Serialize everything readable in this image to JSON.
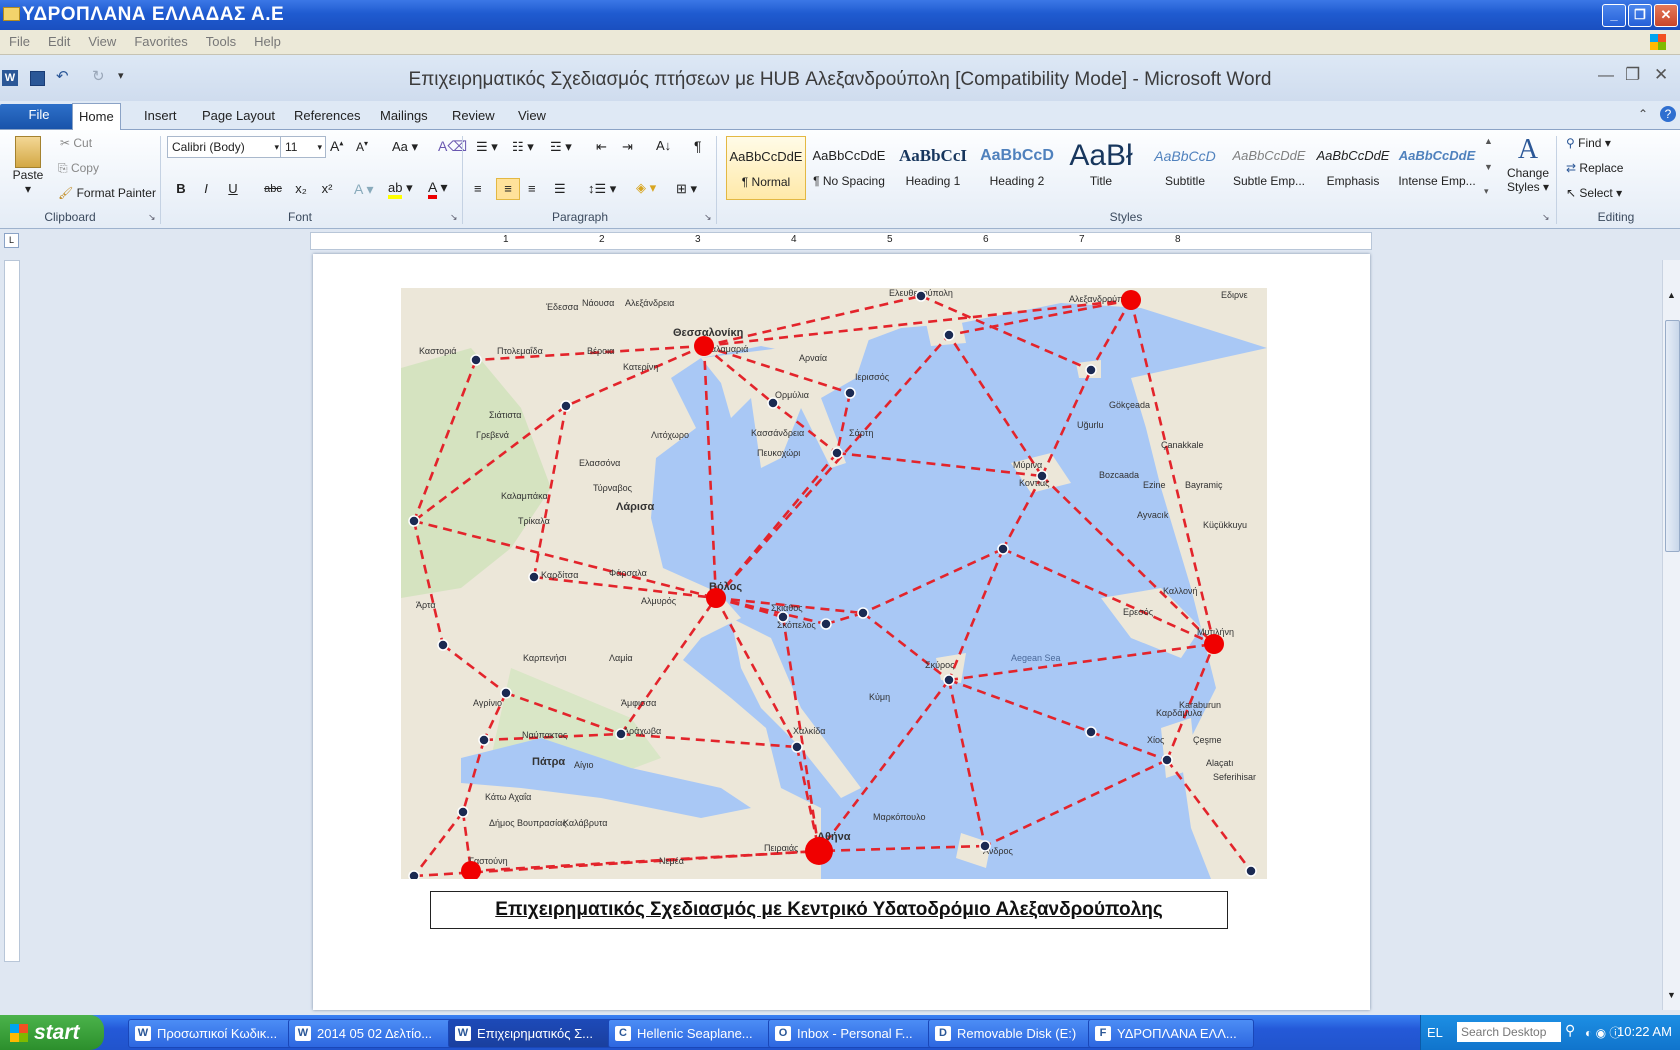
{
  "xp_window": {
    "title": "ΥΔΡΟΠΛΑΝΑ ΕΛΛΑΔΑΣ Α.Ε",
    "menu": [
      "File",
      "Edit",
      "View",
      "Favorites",
      "Tools",
      "Help"
    ]
  },
  "word": {
    "title": "Επιχειρηματικός Σχεδιασμός  πτήσεων με HUB Αλεξανδρούπολη [Compatibility Mode]  -  Microsoft Word",
    "tabs": [
      "File",
      "Home",
      "Insert",
      "Page Layout",
      "References",
      "Mailings",
      "Review",
      "View"
    ],
    "active_tab": "Home",
    "clipboard": {
      "paste": "Paste",
      "cut": "Cut",
      "copy": "Copy",
      "format_painter": "Format Painter",
      "label": "Clipboard"
    },
    "font": {
      "name": "Calibri (Body)",
      "size": "11",
      "label": "Font",
      "buttons": [
        "B",
        "I",
        "U",
        "abc",
        "x₂",
        "x²"
      ]
    },
    "paragraph": {
      "label": "Paragraph"
    },
    "styles": {
      "label": "Styles",
      "items": [
        {
          "sample": "AaBbCcDdE",
          "name": "¶ Normal"
        },
        {
          "sample": "AaBbCcDdE",
          "name": "¶ No Spacing"
        },
        {
          "sample": "AaBbCcI",
          "name": "Heading 1"
        },
        {
          "sample": "AaBbCcD",
          "name": "Heading 2"
        },
        {
          "sample": "AaBł",
          "name": "Title"
        },
        {
          "sample": "AaBbCcD",
          "name": "Subtitle"
        },
        {
          "sample": "AaBbCcDdE",
          "name": "Subtle Emp..."
        },
        {
          "sample": "AaBbCcDdE",
          "name": "Emphasis"
        },
        {
          "sample": "AaBbCcDdE",
          "name": "Intense Emp..."
        }
      ],
      "change_styles": "Change Styles"
    },
    "editing": {
      "label": "Editing",
      "find": "Find",
      "replace": "Replace",
      "select": "Select"
    },
    "ruler_numbers": [
      "1",
      "2",
      "3",
      "4",
      "5",
      "6",
      "7",
      "8"
    ],
    "caption": "Επιχειρηματικός Σχεδιασμός με Κεντρικό Υδατοδρόμιο Αλεξανδρούπολης"
  },
  "map": {
    "labels": [
      "Ελευθερούπολη",
      "Αλεξανδρούπολη",
      "Θεσσαλονίκη",
      "Καλαμαριά",
      "Έδεσσα",
      "Νάουσα",
      "Αλεξάνδρεια",
      "Καστοριά",
      "Πτολεμαΐδα",
      "Βέροια",
      "Αρναία",
      "Ιερισσός",
      "Ορμύλια",
      "Κατερίνη",
      "Σιάτιστα",
      "Γρεβενά",
      "Λιτόχωρο",
      "Ελασσόνα",
      "Κασσάνδρεια",
      "Πευκοχώρι",
      "Σάρτη",
      "Μύρινα",
      "Κοντιάς",
      "Gökçeada",
      "Uğurlu",
      "Çanakkale",
      "Bozcaada",
      "Ezine",
      "Bayramiç",
      "Ayvacık",
      "Küçükkuyu",
      "Λάρισα",
      "Τύρναβος",
      "Καλαμπάκα",
      "Τρίκαλα",
      "Φάρσαλα",
      "Καρδίτσα",
      "Βόλος",
      "Αλμυρός",
      "Σκιάθος",
      "Σκόπελος",
      "Άρτα",
      "Λαμία",
      "Καρπενήσι",
      "Αγρίνιο",
      "Άμφισσα",
      "Αράχωβα",
      "Ναύπακτος",
      "Πάτρα",
      "Αίγιο",
      "Χαλκίδα",
      "Κύμη",
      "Σκύρος",
      "Aegean Sea",
      "Ερεσός",
      "Καλλονή",
      "Μυτιλήνη",
      "Karaburun",
      "Καρδάμυλα",
      "Χίος",
      "Çeşme",
      "Alaçatı",
      "Seferihisar",
      "Αθήνα",
      "Πειραιάς",
      "Μαρκόπουλο",
      "Άνδρος",
      "Κάτω Αχαΐα",
      "Δήμος Βουπρασίας",
      "Καλάβρυτα",
      "Νεμέα",
      "Γαστούνη",
      "Εδιρνε"
    ],
    "hubs": [
      "Αλεξανδρούπολη",
      "Θεσσαλονίκη",
      "Βόλος",
      "Μυτιλήνη",
      "Αθήνα",
      "Γαστούνη"
    ],
    "colors": {
      "sea": "#a9c8f5",
      "land": "#efe9dc",
      "route": "#e3242b",
      "hub": "#f00000",
      "node": "#1b2a52"
    }
  },
  "taskbar": {
    "start": "start",
    "tasks": [
      {
        "label": "Προσωπικοί Κωδικ...",
        "icon": "W"
      },
      {
        "label": "2014 05 02 Δελτίο...",
        "icon": "W"
      },
      {
        "label": "Επιχειρηματικός Σ...",
        "icon": "W"
      },
      {
        "label": "Hellenic Seaplane...",
        "icon": "C"
      },
      {
        "label": "Inbox - Personal F...",
        "icon": "O"
      },
      {
        "label": "Removable Disk (E:)",
        "icon": "D"
      },
      {
        "label": "ΥΔΡΟΠΛΑΝΑ ΕΛΛ...",
        "icon": "F"
      }
    ],
    "lang": "EL",
    "search_placeholder": "Search Desktop",
    "clock": "10:22 AM"
  }
}
